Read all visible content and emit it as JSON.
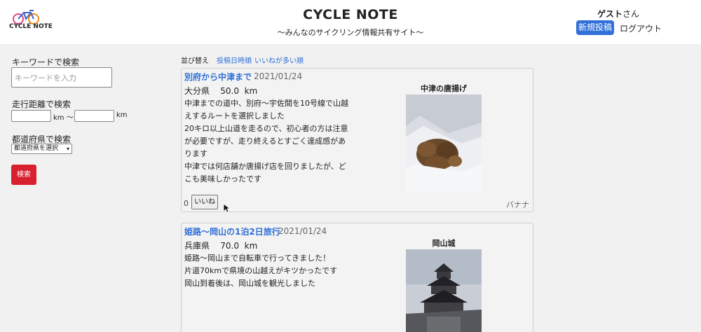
{
  "header": {
    "logo_text": "CYCLE NOTE",
    "title": "CYCLE NOTE",
    "subtitle": "〜みんなのサイクリング情報共有サイト〜",
    "guest_name": "ゲスト",
    "guest_suffix": "さん",
    "new_post": "新規投稿",
    "logout": "ログアウト"
  },
  "sidebar": {
    "keyword_label": "キーワードで検索",
    "keyword_placeholder": "キーワードを入力",
    "distance_label": "走行距離で検索",
    "km1": "km 〜",
    "km2": "km",
    "pref_label": "都道府県で検索",
    "pref_selected": "都道府県を選択",
    "search_button": "検索"
  },
  "sort": {
    "label": "並び替え",
    "by_date": "投稿日時順",
    "by_likes": "いいねが多い順"
  },
  "posts": [
    {
      "title": "別府から中津まで",
      "date": "2021/01/24",
      "prefecture": "大分県",
      "distance": "50.0",
      "unit": "km",
      "body": [
        "中津までの道中、別府〜宇佐間を10号線で山越",
        "えするルートを選択しました",
        "20キロ以上山道を走るので、初心者の方は注意",
        "が必要ですが、走り終えるとすごく達成感があ",
        "ります",
        "中津では何店舗か唐揚げ店を回りましたが、ど",
        "こも美味しかったです"
      ],
      "photo_title": "中津の唐揚げ",
      "likes": "0",
      "like_label": "いいね",
      "author": "バナナ"
    },
    {
      "title": "姫路〜岡山の1泊2日旅行",
      "date": "2021/01/24",
      "prefecture": "兵庫県",
      "distance": "70.0",
      "unit": "km",
      "body": [
        "姫路〜岡山まで自転車で行ってきました！",
        "片道70kmで県境の山越えがキツかったです",
        "岡山到着後は、岡山城を観光しました"
      ],
      "photo_title": "岡山城"
    }
  ],
  "colors": {
    "accent": "#2f6fd8",
    "search_button": "#d9202e"
  }
}
